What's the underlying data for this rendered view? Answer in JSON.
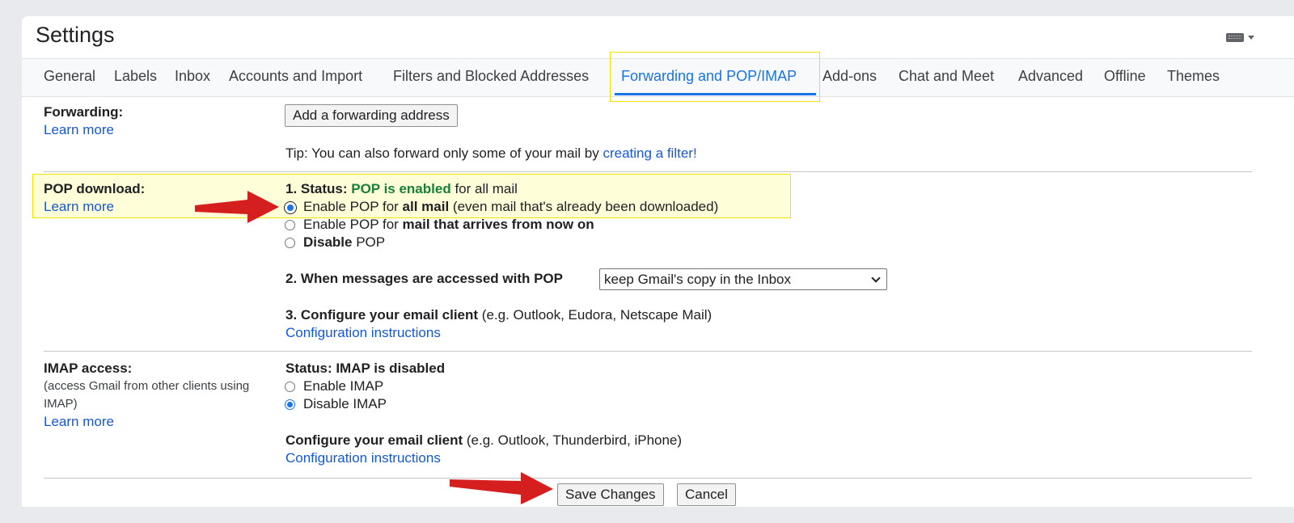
{
  "header": {
    "title": "Settings",
    "icons": [
      "keyboard-icon",
      "caret-down-icon"
    ]
  },
  "tabs": [
    {
      "label": "General"
    },
    {
      "label": "Labels"
    },
    {
      "label": "Inbox"
    },
    {
      "label": "Accounts and Import"
    },
    {
      "label": "Filters and Blocked Addresses"
    },
    {
      "label": "Forwarding and POP/IMAP"
    },
    {
      "label": "Add-ons"
    },
    {
      "label": "Chat and Meet"
    },
    {
      "label": "Advanced"
    },
    {
      "label": "Offline"
    },
    {
      "label": "Themes"
    }
  ],
  "forwarding": {
    "label": "Forwarding:",
    "learn_more": "Learn more",
    "add_button": "Add a forwarding address",
    "tip_prefix": "Tip: You can also forward only some of your mail by ",
    "tip_link": "creating a filter!"
  },
  "pop": {
    "label": "POP download:",
    "learn_more": "Learn more",
    "status_prefix": "1. Status: ",
    "status_value": "POP is enabled",
    "status_suffix": " for all mail",
    "opt1_a": "Enable POP for ",
    "opt1_b": "all mail",
    "opt1_c": " (even mail that's already been downloaded)",
    "opt2_a": "Enable POP for ",
    "opt2_b": "mail that arrives from now on",
    "opt3_a": "Disable",
    "opt3_b": " POP",
    "when_label": "2. When messages are accessed with POP",
    "when_value": "keep Gmail's copy in the Inbox",
    "config_label": "3. Configure your email client",
    "config_suffix": " (e.g. Outlook, Eudora, Netscape Mail)",
    "config_link": "Configuration instructions"
  },
  "imap": {
    "label": "IMAP access:",
    "desc_line1": "(access Gmail from other clients using",
    "desc_line2": "IMAP)",
    "learn_more": "Learn more",
    "status": "Status: IMAP is disabled",
    "opt_enable": "Enable IMAP",
    "opt_disable": "Disable IMAP",
    "config_label": "Configure your email client",
    "config_suffix": " (e.g. Outlook, Thunderbird, iPhone)",
    "config_link": "Configuration instructions"
  },
  "footer": {
    "save": "Save Changes",
    "cancel": "Cancel"
  },
  "colors": {
    "accent": "#1a73e8",
    "link": "#1558d6",
    "status_green": "#188038",
    "highlight": "#f5e000",
    "arrow": "#d51f1f"
  }
}
